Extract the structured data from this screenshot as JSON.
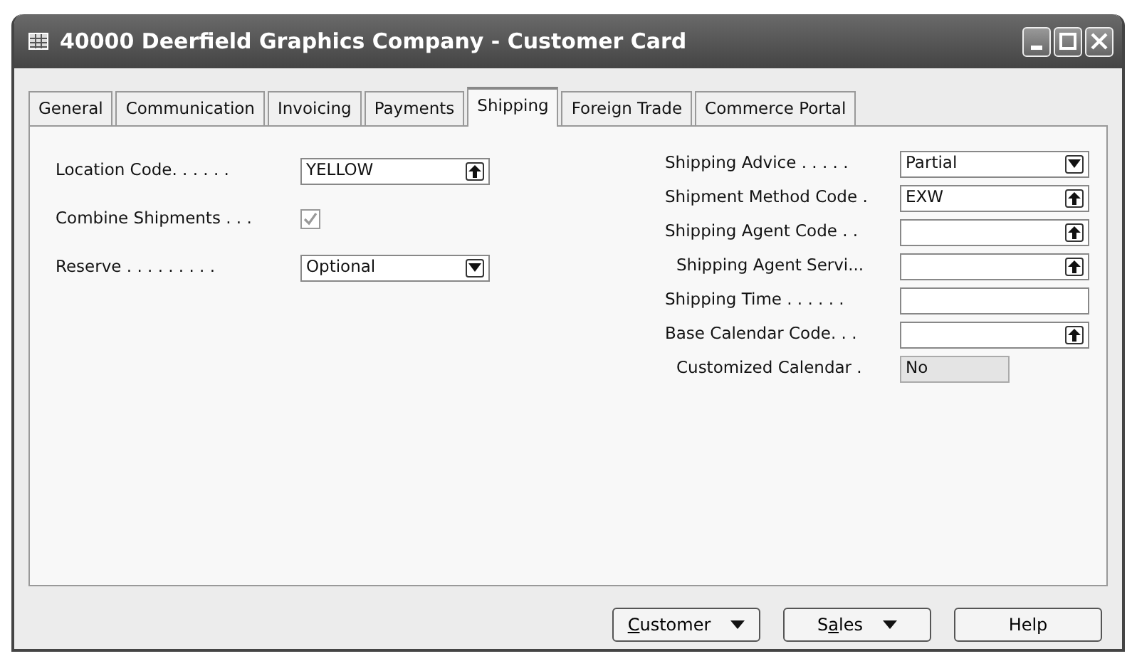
{
  "window": {
    "title": "40000 Deerfield Graphics Company - Customer Card"
  },
  "tabs": [
    {
      "label": "General",
      "selected": false
    },
    {
      "label": "Communication",
      "selected": false
    },
    {
      "label": "Invoicing",
      "selected": false
    },
    {
      "label": "Payments",
      "selected": false
    },
    {
      "label": "Shipping",
      "selected": true
    },
    {
      "label": "Foreign Trade",
      "selected": false
    },
    {
      "label": "Commerce Portal",
      "selected": false
    }
  ],
  "left_fields": [
    {
      "label": "Location Code. . . . . .",
      "kind": "lookup",
      "value": "YELLOW"
    },
    {
      "label": "Combine Shipments . . .",
      "kind": "checkbox",
      "checked": true,
      "disabled": true
    },
    {
      "label": "Reserve . . . . . . . . .",
      "kind": "dropdown",
      "value": "Optional"
    }
  ],
  "right_fields": [
    {
      "label": "Shipping Advice . . . . .",
      "kind": "dropdown",
      "value": "Partial",
      "indented": false
    },
    {
      "label": "Shipment Method Code .",
      "kind": "lookup",
      "value": "EXW",
      "indented": false
    },
    {
      "label": "Shipping Agent Code . .",
      "kind": "lookup",
      "indented": false
    },
    {
      "label": "Shipping Agent Servi...",
      "kind": "lookup",
      "indented": true
    },
    {
      "label": "Shipping Time . . . . . .",
      "kind": "text",
      "indented": false
    },
    {
      "label": "Base Calendar Code. . .",
      "kind": "lookup",
      "indented": false
    },
    {
      "label": "Customized Calendar  .",
      "kind": "readonly",
      "value": "No",
      "indented": true
    }
  ],
  "buttons": [
    {
      "accesskey": "C",
      "label_after_key": "ustomer",
      "menu": true
    },
    {
      "label_before_key": "S",
      "accesskey": "a",
      "label_after_key": "les",
      "menu": true
    },
    {
      "label": "Help",
      "menu": false
    }
  ]
}
